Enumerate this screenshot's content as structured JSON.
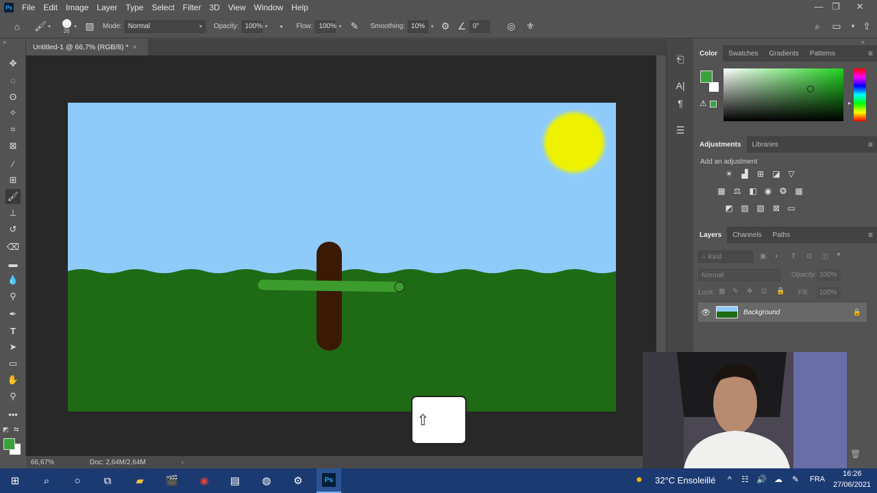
{
  "app": {
    "logo": "Ps"
  },
  "menu": [
    "File",
    "Edit",
    "Image",
    "Layer",
    "Type",
    "Select",
    "Filter",
    "3D",
    "View",
    "Window",
    "Help"
  ],
  "options": {
    "brush_size": "26",
    "mode_label": "Mode:",
    "mode_value": "Normal",
    "opacity_label": "Opacity:",
    "opacity_value": "100%",
    "flow_label": "Flow:",
    "flow_value": "100%",
    "smoothing_label": "Smoothing:",
    "smoothing_value": "10%",
    "angle_value": "0°"
  },
  "document": {
    "tab_title": "Untitled-1 @ 66,7% (RGB/8) *",
    "close_glyph": "×"
  },
  "status": {
    "zoom": "66,67%",
    "doc_info": "Doc: 2,64M/2,64M",
    "arrow": "›"
  },
  "panels": {
    "color_tabs": [
      "Color",
      "Swatches",
      "Gradients",
      "Patterns"
    ],
    "adjust_tabs": [
      "Adjustments",
      "Libraries"
    ],
    "add_adjustment": "Add an adjustment",
    "layers_tabs": [
      "Layers",
      "Channels",
      "Paths"
    ],
    "kind_placeholder": "Kind",
    "blend_mode": "Normal",
    "opacity_label": "Opacity:",
    "opacity_value": "100%",
    "lock_label": "Lock:",
    "fill_label": "Fill:",
    "fill_value": "100%",
    "layer_name": "Background"
  },
  "colors": {
    "foreground": "#3aa23a",
    "sky": "#8ecbfb",
    "grass": "#1f6a14",
    "sun": "#eef203",
    "trunk": "#3a1a02",
    "stroke": "#3c9c2e"
  },
  "shift_key": {
    "glyph": "⇧"
  },
  "taskbar": {
    "weather": "32°C Ensoleillé",
    "lang": "FRA",
    "time": "16:26",
    "date": "27/06/2021"
  }
}
